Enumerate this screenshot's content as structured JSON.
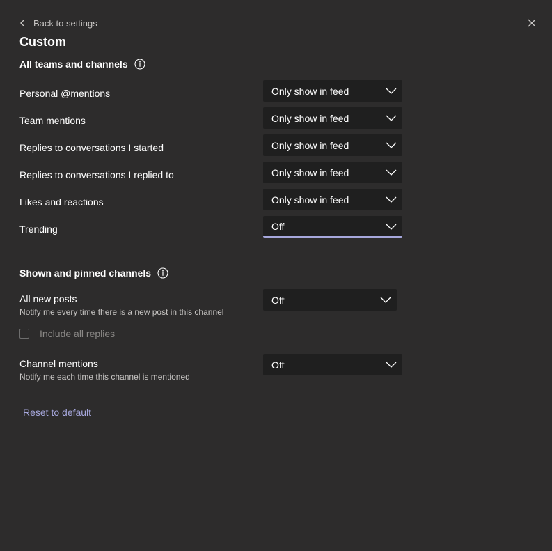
{
  "header": {
    "back_label": "Back to settings",
    "title": "Custom"
  },
  "sections": {
    "all_teams": {
      "heading": "All teams and channels",
      "rows": [
        {
          "label": "Personal @mentions",
          "value": "Only show in feed"
        },
        {
          "label": "Team mentions",
          "value": "Only show in feed"
        },
        {
          "label": "Replies to conversations I started",
          "value": "Only show in feed"
        },
        {
          "label": "Replies to conversations I replied to",
          "value": "Only show in feed"
        },
        {
          "label": "Likes and reactions",
          "value": "Only show in feed"
        },
        {
          "label": "Trending",
          "value": "Off"
        }
      ]
    },
    "shown_pinned": {
      "heading": "Shown and pinned channels",
      "all_new_posts": {
        "label": "All new posts",
        "description": "Notify me every time there is a new post in this channel",
        "value": "Off"
      },
      "include_all_replies": {
        "label": "Include all replies",
        "checked": false
      },
      "channel_mentions": {
        "label": "Channel mentions",
        "description": "Notify me each time this channel is mentioned",
        "value": "Off"
      }
    }
  },
  "footer": {
    "reset_label": "Reset to default"
  },
  "colors": {
    "background": "#2d2c2c",
    "dropdown_bg": "#1f1f1f",
    "accent": "#a6a7dc",
    "muted_text": "#c8c6c4"
  },
  "icons": {
    "back": "chevron-left-icon",
    "close": "close-icon",
    "info": "info-icon",
    "dropdown": "chevron-down-icon"
  }
}
